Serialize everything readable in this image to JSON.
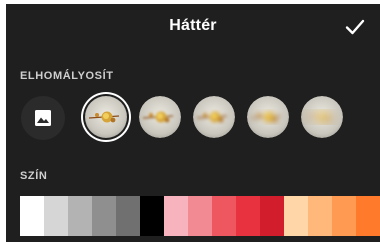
{
  "header": {
    "title": "Háttér",
    "confirm_icon": "checkmark-icon"
  },
  "blur": {
    "label": "ELHOMÁLYOSÍT",
    "image_button_icon": "image-icon",
    "options": [
      {
        "level": 0,
        "selected": true
      },
      {
        "level": 1,
        "selected": false
      },
      {
        "level": 2,
        "selected": false
      },
      {
        "level": 3,
        "selected": false
      },
      {
        "level": 4,
        "selected": false
      }
    ]
  },
  "color": {
    "label": "SZÍN",
    "swatches": [
      "#ffffff",
      "#d6d6d6",
      "#b3b3b3",
      "#8f8f8f",
      "#707070",
      "#000000",
      "#f7b3be",
      "#f28a93",
      "#ee5660",
      "#e8323f",
      "#d11d2c",
      "#fed6a8",
      "#ffb77a",
      "#ff9a52",
      "#ff7a2a"
    ]
  }
}
